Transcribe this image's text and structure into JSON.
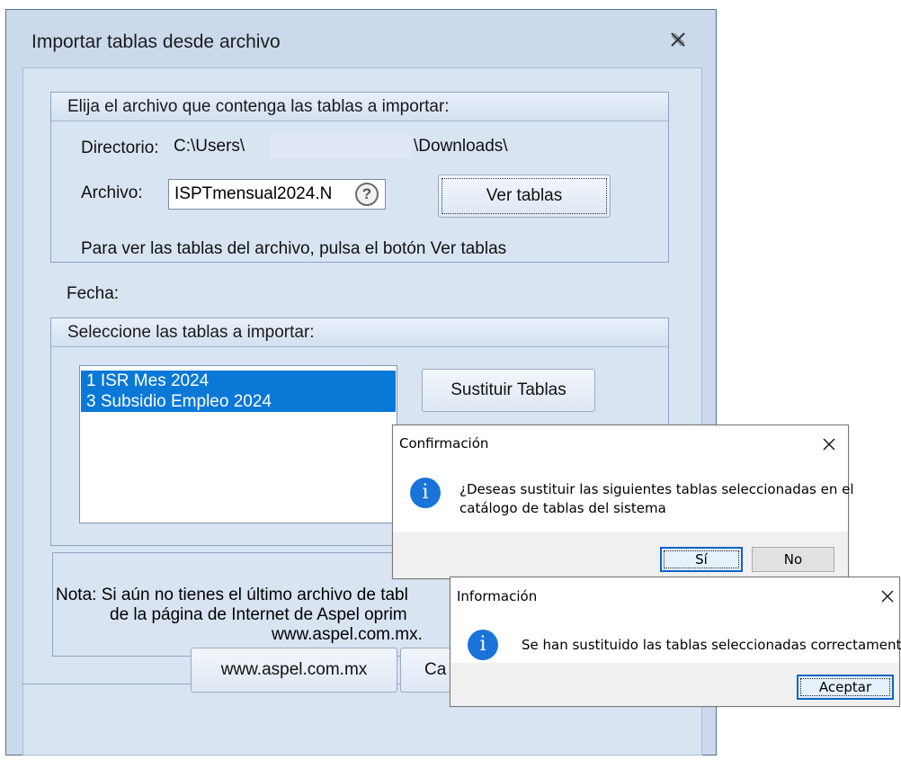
{
  "main_window": {
    "title": "Importar tablas desde archivo",
    "close_icon": "close-x-icon",
    "file_group": {
      "header": "Elija el archivo que contenga las tablas a importar:",
      "directory_label": "Directorio:",
      "directory_value_start": "C:\\Users\\",
      "directory_value_end": "\\Downloads\\",
      "file_label": "Archivo:",
      "file_value": "ISPTmensual2024.N",
      "help_icon": "question-circle-icon",
      "view_tables_button": "Ver tablas",
      "hint": "Para ver las tablas del archivo, pulsa el botón Ver tablas"
    },
    "date_label": "Fecha:",
    "tables_group": {
      "header": "Seleccione las tablas a importar:",
      "items": [
        "1 ISR Mes 2024",
        "3 Subsidio Empleo 2024"
      ],
      "replace_button": "Sustituir Tablas"
    },
    "note": {
      "line1": "Nota: Si aún no tienes el último archivo de tabl",
      "line2": "de la página de Internet de Aspel oprim",
      "line3": "www.aspel.com.mx."
    },
    "bottom_buttons": {
      "website": "www.aspel.com.mx",
      "cancel_partial": "Ca"
    }
  },
  "confirm_dialog": {
    "title": "Confirmación",
    "icon": "info-icon",
    "message_line1": "¿Deseas sustituir las siguientes tablas seleccionadas en el",
    "message_line2": "catálogo de tablas del sistema",
    "yes_button": "Sí",
    "no_button": "No"
  },
  "info_dialog": {
    "title": "Información",
    "icon": "info-icon",
    "message": "Se han sustituido las tablas seleccionadas correctamente",
    "ok_button": "Aceptar"
  },
  "colors": {
    "window_bg": "#cbd9ec",
    "list_selection": "#0a78d7",
    "dialog_footer": "#f0f0f0",
    "info_icon": "#1a73d9"
  }
}
